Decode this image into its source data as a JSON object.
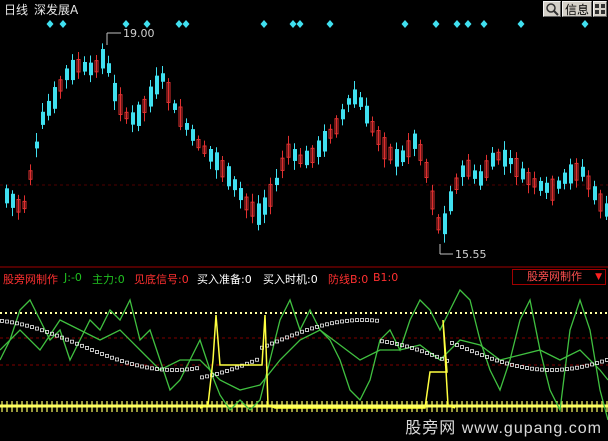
{
  "header": {
    "period": "日线",
    "stock_name": "深发展A",
    "buttons": {
      "zoom_icon": "magnifier-icon",
      "info": "信息",
      "menu_icon": "grid-icon"
    }
  },
  "price_labels": {
    "high": "19.00",
    "low": "15.55"
  },
  "indicator_status": {
    "name": "股旁网制作",
    "items": [
      {
        "label": "J:",
        "value": "-0",
        "color": "#20c020"
      },
      {
        "label": "主力:",
        "value": "0",
        "color": "#20c020"
      },
      {
        "label": "见底信号:",
        "value": "0",
        "color": "#ff3030"
      },
      {
        "label": "买入准备:",
        "value": "0",
        "color": "#ffffff"
      },
      {
        "label": "买入时机:",
        "value": "0",
        "color": "#ffffff"
      },
      {
        "label": "防线B:",
        "value": "0",
        "color": "#ff3030"
      },
      {
        "label": "B1:",
        "value": "0",
        "color": "#ff3030"
      }
    ]
  },
  "indicator_selector": {
    "value": "股旁网制作"
  },
  "watermark": "股旁网 www.gupang.com",
  "colors": {
    "up": "#e03030",
    "down": "#40e0f0",
    "signal_diamond": "#40e0f0",
    "line_green": "#40c040",
    "line_yellow": "#ffff40",
    "grid_red": "#800000"
  }
}
